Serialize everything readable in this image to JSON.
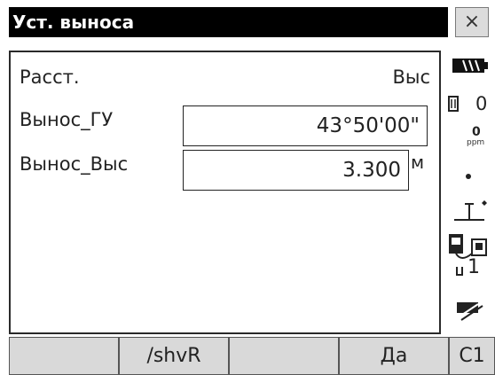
{
  "window": {
    "title": "Уст. выноса",
    "close_glyph": "×"
  },
  "panel": {
    "header_left": "Расст.",
    "header_right": "Выс",
    "rows": [
      {
        "label": "Вынос_ГУ",
        "value": "43°50'00\"",
        "unit": ""
      },
      {
        "label": "Вынос_Выс",
        "value": "3.300",
        "unit": "м"
      }
    ]
  },
  "status": {
    "battery_icon": "battery-icon",
    "prism_constant": "0",
    "ppm_value": "0",
    "ppm_label": "ppm",
    "tilt_icon": "tilt-sensor-icon",
    "target_icon": "target-icon",
    "comm_icon": "communication-icon",
    "prism_id": "1",
    "laser_icon": "laser-pointer-icon"
  },
  "fkeys": [
    "",
    "/shvR",
    "",
    "Да",
    "С1"
  ]
}
